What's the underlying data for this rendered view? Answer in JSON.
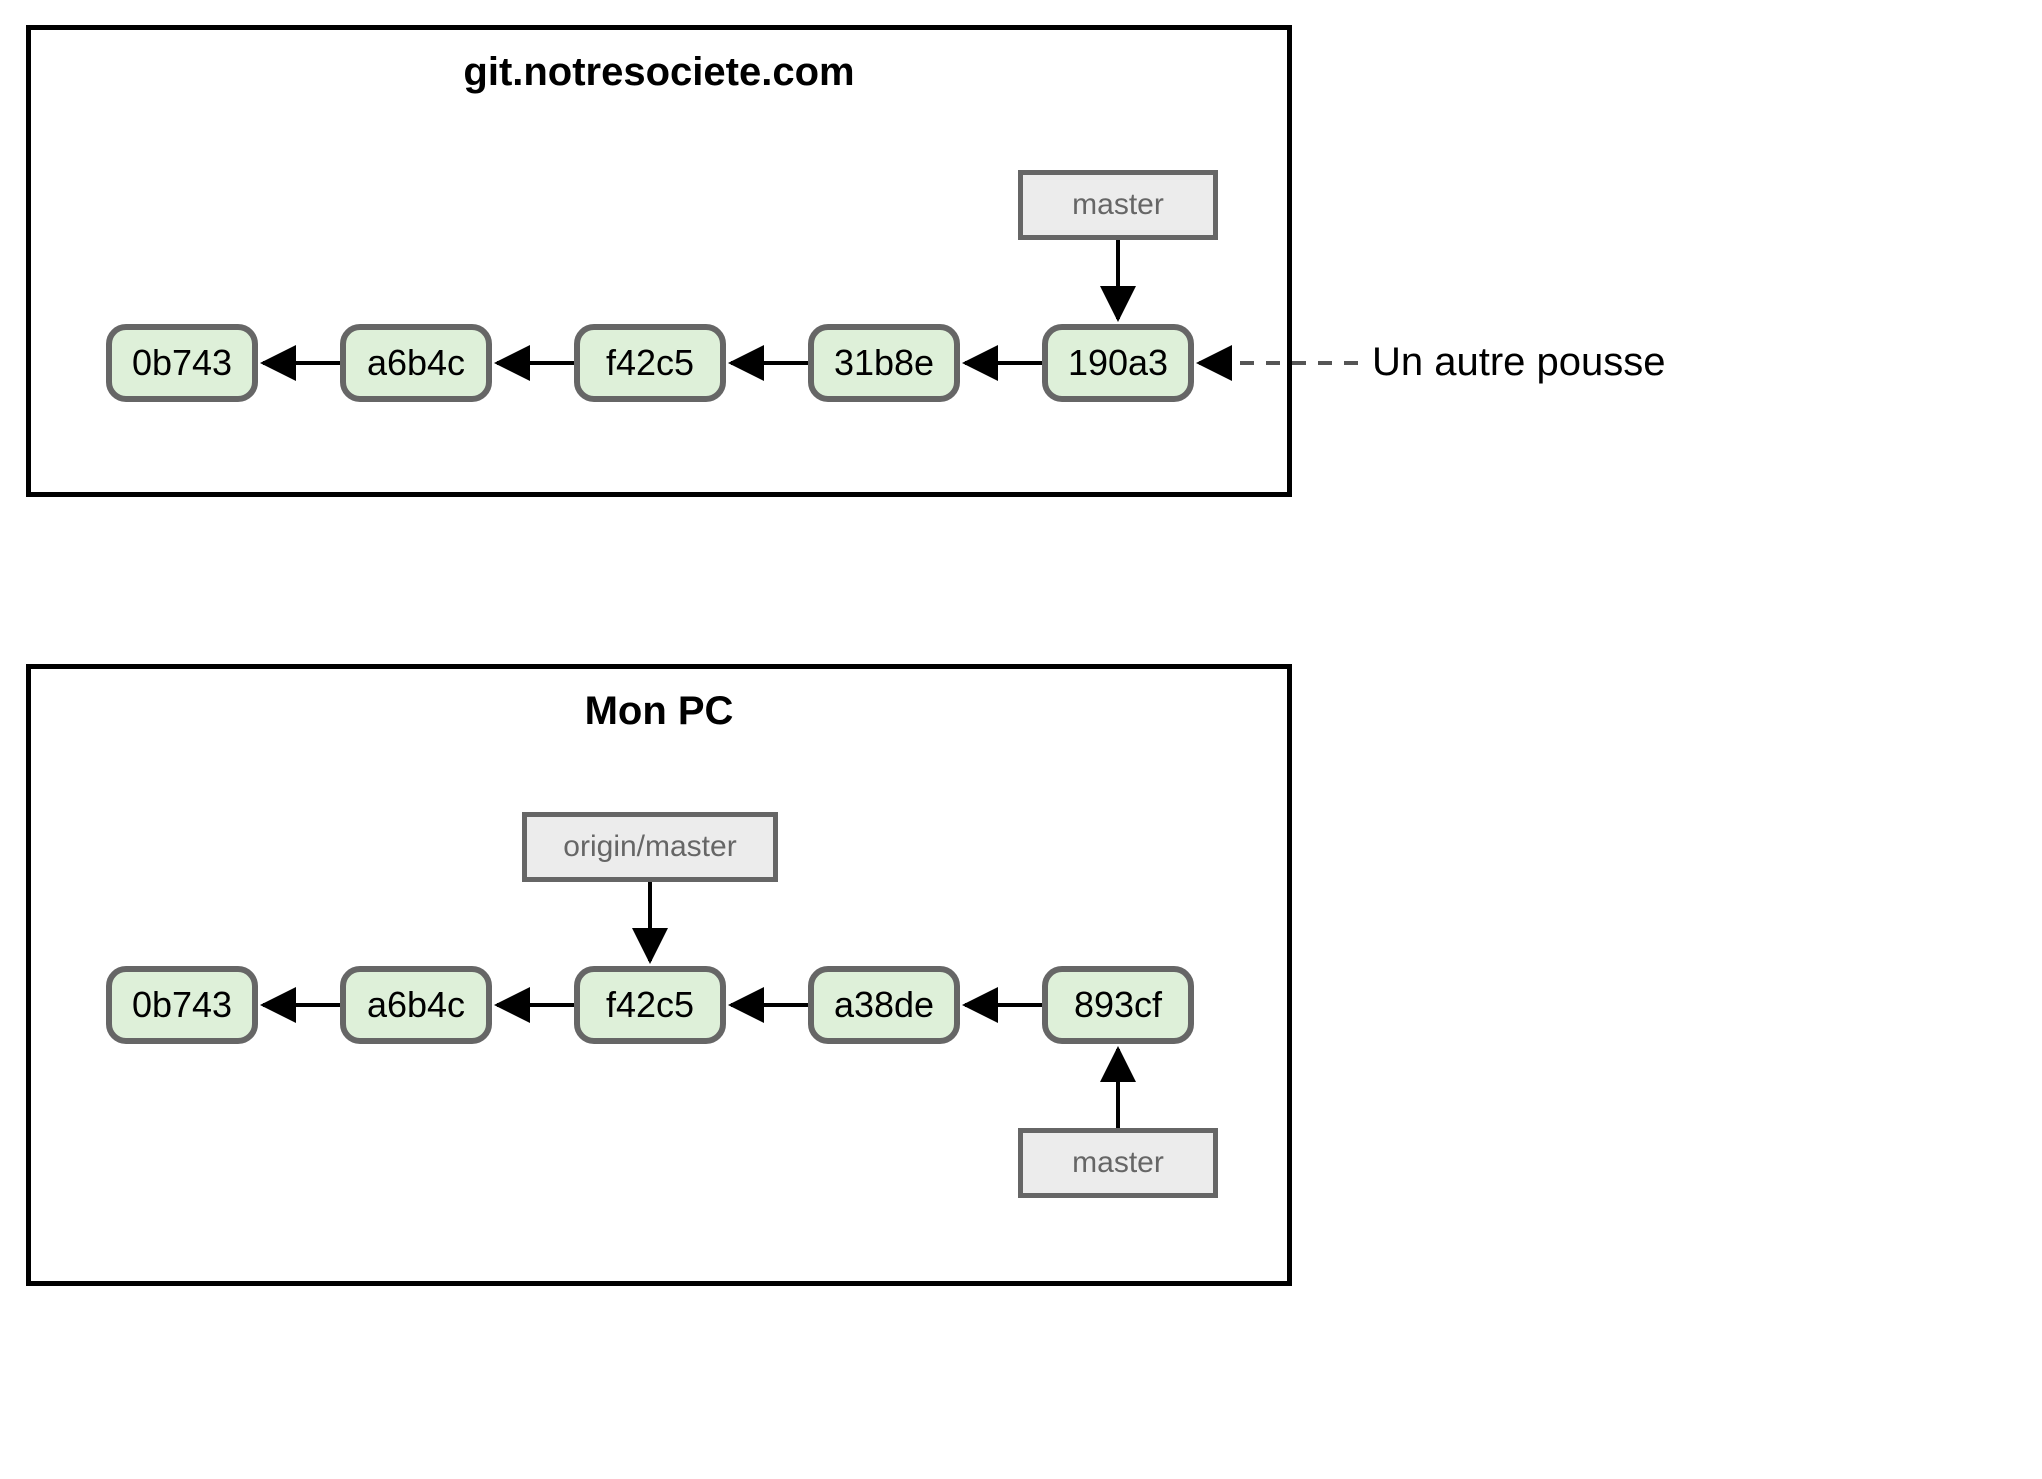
{
  "remote": {
    "title": "git.notresociete.com",
    "commits": [
      "0b743",
      "a6b4c",
      "f42c5",
      "31b8e",
      "190a3"
    ],
    "branch": {
      "name": "master"
    },
    "incoming_label": "Un autre pousse"
  },
  "local": {
    "title": "Mon PC",
    "commits": [
      "0b743",
      "a6b4c",
      "f42c5",
      "a38de",
      "893cf"
    ],
    "remote_branch": {
      "name": "origin/master"
    },
    "branch": {
      "name": "master"
    }
  },
  "colors": {
    "commit_fill": "#def0d9",
    "node_border": "#666666",
    "label_fill": "#ececec"
  }
}
